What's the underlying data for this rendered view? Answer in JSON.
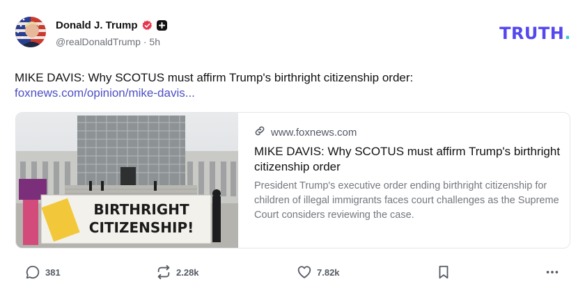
{
  "author": {
    "name": "Donald J. Trump",
    "handle": "@realDonaldTrump",
    "time": "· 5h"
  },
  "brand": {
    "logo_text": "TRUTH",
    "logo_dot": "."
  },
  "post": {
    "text": "MIKE DAVIS: Why SCOTUS must affirm Trump's birthright citizenship order:",
    "link_text": "foxnews.com/opinion/mike-davis..."
  },
  "card": {
    "domain": "www.foxnews.com",
    "title": "MIKE DAVIS: Why SCOTUS must affirm Trump's birthright citizenship order",
    "description": "President Trump's executive order ending birthright citizenship for children of illegal immigrants faces court challenges as the Supreme Court considers reviewing the case.",
    "image_banner_line1": "BIRTHRIGHT",
    "image_banner_line2": "CITIZENSHIP!"
  },
  "actions": {
    "replies": "381",
    "retruths": "2.28k",
    "likes": "7.82k"
  },
  "colors": {
    "brand": "#5448ee",
    "link": "#4c4ec5",
    "verified": "#e8364f",
    "muted": "#6b6f76"
  }
}
